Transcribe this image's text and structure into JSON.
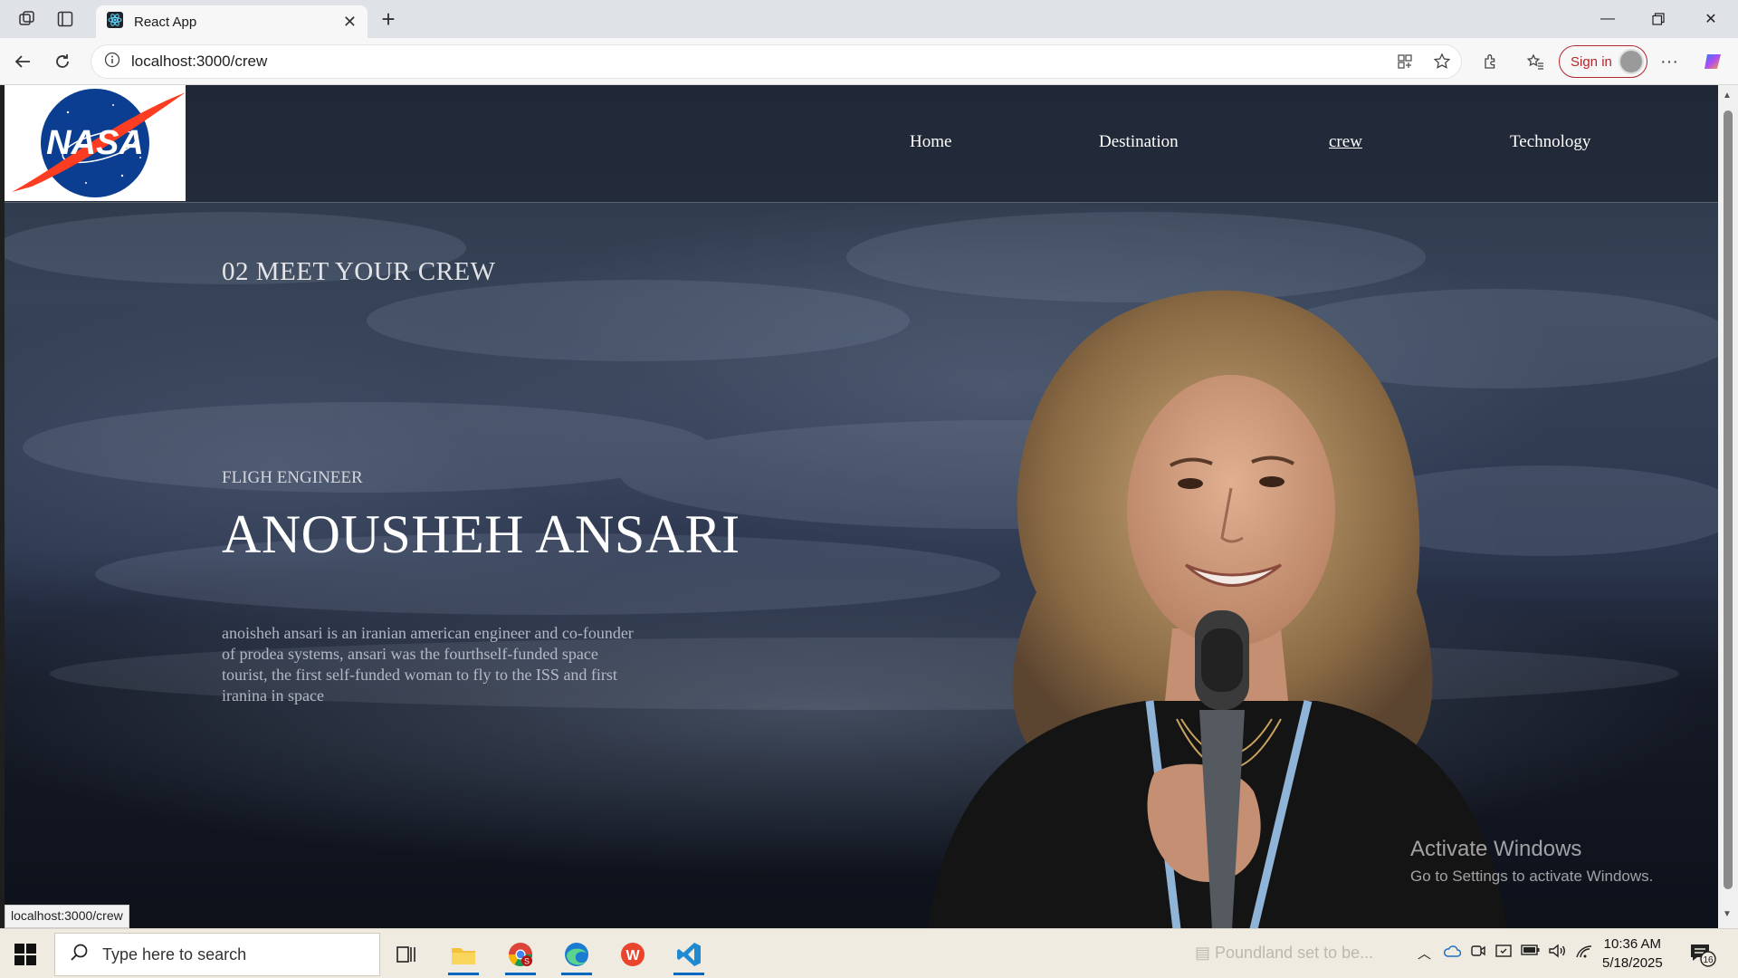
{
  "browser": {
    "tab_title": "React App",
    "url": "localhost:3000/crew",
    "signin_label": "Sign in",
    "status_url": "localhost:3000/crew"
  },
  "site": {
    "logo_text": "NASA",
    "nav": [
      {
        "label": "Home",
        "active": false
      },
      {
        "label": "Destination",
        "active": false
      },
      {
        "label": "crew",
        "active": true
      },
      {
        "label": "Technology",
        "active": false
      }
    ],
    "section_title": "02 MEET YOUR CREW",
    "crew_role": "FLIGH ENGINEER",
    "crew_name": "ANOUSHEH ANSARI",
    "crew_bio": "anoisheh ansari is an iranian american engineer and co-founder of prodea systems, ansari was the fourthself-funded space tourist, the first self-funded woman to fly to the ISS and first iranina in space"
  },
  "watermark": {
    "line1": "Activate Windows",
    "line2": "Go to Settings to activate Windows."
  },
  "taskbar": {
    "search_placeholder": "Type here to search",
    "news_text": "Poundland set to be...",
    "time": "10:36 AM",
    "date": "5/18/2025",
    "notification_count": "16"
  },
  "colors": {
    "signin": "#b3262c",
    "nasa_blue": "#0b3d91",
    "nasa_red": "#fc3d21"
  }
}
